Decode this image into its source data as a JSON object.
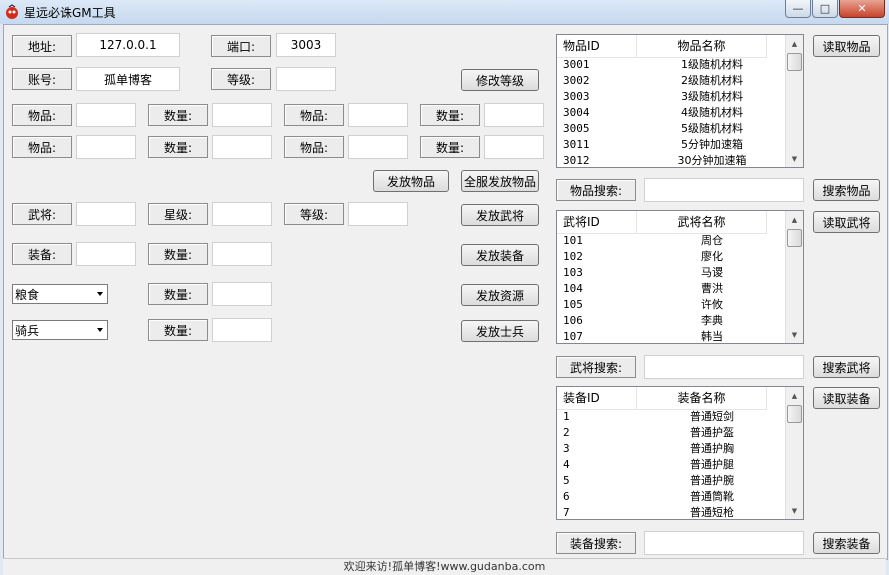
{
  "window": {
    "title": "星远必诛GM工具",
    "minimize_glyph": "—",
    "maximize_glyph": "□",
    "close_glyph": "✕"
  },
  "form": {
    "address_label": "地址:",
    "address_value": "127.0.0.1",
    "port_label": "端口:",
    "port_value": "3003",
    "account_label": "账号:",
    "account_value": "孤单博客",
    "level_label": "等级:",
    "level_value": "",
    "modify_level_button": "修改等级",
    "item_label": "物品:",
    "quantity_label": "数量:",
    "send_items_button": "发放物品",
    "send_all_items_button": "全服发放物品",
    "general_label": "武将:",
    "star_label": "星级:",
    "general_level_label": "等级:",
    "send_general_button": "发放武将",
    "equipment_label": "装备:",
    "send_equipment_button": "发放装备",
    "resource_select": "粮食",
    "send_resource_button": "发放资源",
    "soldier_select": "骑兵",
    "send_soldier_button": "发放士兵"
  },
  "items": {
    "col_id": "物品ID",
    "col_name": "物品名称",
    "rows": [
      [
        "3001",
        "1级随机材料"
      ],
      [
        "3002",
        "2级随机材料"
      ],
      [
        "3003",
        "3级随机材料"
      ],
      [
        "3004",
        "4级随机材料"
      ],
      [
        "3005",
        "5级随机材料"
      ],
      [
        "3011",
        "5分钟加速箱"
      ],
      [
        "3012",
        "30分钟加速箱"
      ]
    ],
    "read_button": "读取物品",
    "search_label": "物品搜索:",
    "search_button": "搜索物品"
  },
  "generals": {
    "col_id": "武将ID",
    "col_name": "武将名称",
    "rows": [
      [
        "101",
        "周仓"
      ],
      [
        "102",
        "廖化"
      ],
      [
        "103",
        "马谡"
      ],
      [
        "104",
        "曹洪"
      ],
      [
        "105",
        "许攸"
      ],
      [
        "106",
        "李典"
      ],
      [
        "107",
        "韩当"
      ]
    ],
    "read_button": "读取武将",
    "search_label": "武将搜索:",
    "search_button": "搜索武将"
  },
  "equipment": {
    "col_id": "装备ID",
    "col_name": "装备名称",
    "rows": [
      [
        "1",
        "普通短剑"
      ],
      [
        "2",
        "普通护盔"
      ],
      [
        "3",
        "普通护胸"
      ],
      [
        "4",
        "普通护腿"
      ],
      [
        "5",
        "普通护腕"
      ],
      [
        "6",
        "普通筒靴"
      ],
      [
        "7",
        "普通短枪"
      ]
    ],
    "read_button": "读取装备",
    "search_label": "装备搜索:",
    "search_button": "搜索装备"
  },
  "status": {
    "text": "欢迎来访!孤单博客!www.gudanba.com"
  }
}
